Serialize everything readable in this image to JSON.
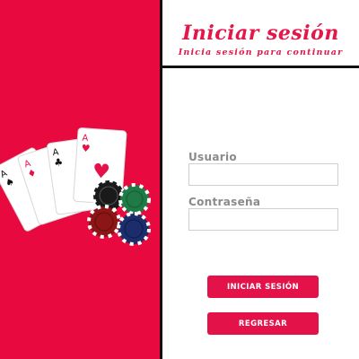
{
  "header": {
    "title": "Iniciar sesión",
    "subtitle": "Inicia sesión para continuar"
  },
  "form": {
    "username_label": "Usuario",
    "username_value": "",
    "password_label": "Contraseña",
    "password_value": ""
  },
  "buttons": {
    "login_label": "INICIAR SESIÓN",
    "back_label": "REGRESAR"
  },
  "illustration": {
    "cards": [
      {
        "rank": "A",
        "suit": "♠",
        "suit_color": "#111111"
      },
      {
        "rank": "A",
        "suit": "♦",
        "suit_color": "#e3134a"
      },
      {
        "rank": "A",
        "suit": "♣",
        "suit_color": "#111111"
      },
      {
        "rank": "A",
        "suit": "♥",
        "suit_color": "#e3134a"
      }
    ],
    "chips": [
      "black-chip",
      "green-chip",
      "red-chip",
      "blue-chip"
    ]
  },
  "colors": {
    "accent": "#e3134a",
    "left_panel": "#e8093f",
    "label_gray": "#8a8a8a"
  }
}
